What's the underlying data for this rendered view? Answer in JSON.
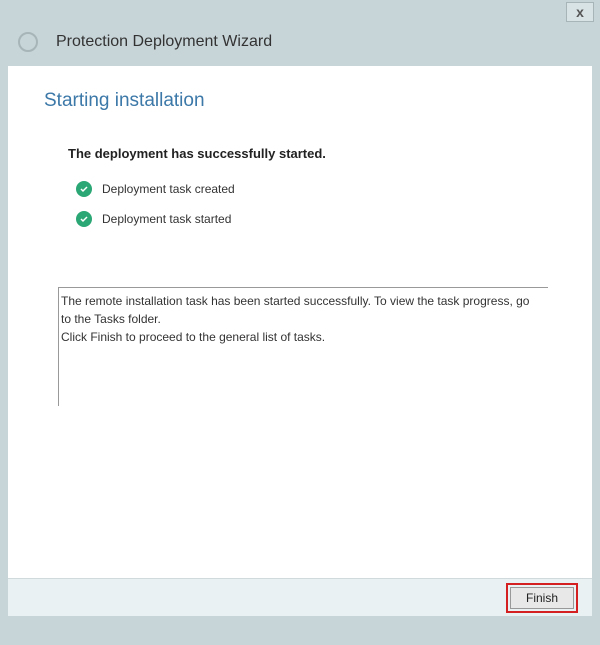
{
  "window": {
    "title": "Protection Deployment Wizard"
  },
  "section": {
    "title": "Starting installation",
    "status_heading": "The deployment has successfully started."
  },
  "status_items": [
    "Deployment task created",
    "Deployment task started"
  ],
  "details": {
    "line1": "The remote installation task has been started successfully. To view the task progress, go to the Tasks folder.",
    "line2": "Click Finish to proceed to the general list of tasks."
  },
  "buttons": {
    "finish": "Finish"
  }
}
